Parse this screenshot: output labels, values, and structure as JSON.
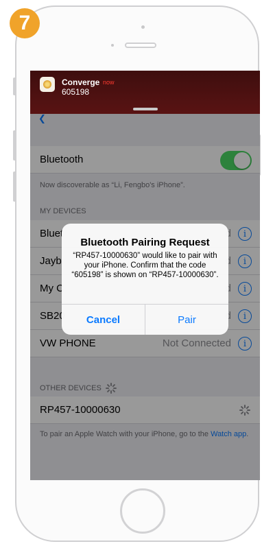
{
  "step_badge": "7",
  "notification": {
    "app_name": "Converge",
    "time": "now",
    "body": "605198"
  },
  "settings": {
    "bluetooth_label": "Bluetooth",
    "bluetooth_on": true,
    "discoverable_text": "Now discoverable as “Li, Fengbo's iPhone”.",
    "my_devices_header": "MY DEVICES",
    "my_devices": [
      {
        "name": "Bluet",
        "status": "d"
      },
      {
        "name": "Jayb",
        "status": "d"
      },
      {
        "name": "My C",
        "status": "d"
      },
      {
        "name": "SB20",
        "status": "d"
      },
      {
        "name": "VW PHONE",
        "status": "Not Connected"
      }
    ],
    "other_devices_header": "OTHER DEVICES",
    "other_devices": [
      {
        "name": "RP457-10000630"
      }
    ],
    "watch_note": "To pair an Apple Watch with your iPhone, go to the",
    "watch_link": "Watch app",
    "watch_note_end": "."
  },
  "alert": {
    "title": "Bluetooth Pairing Request",
    "message": "“RP457-10000630” would like to pair with your iPhone. Confirm that the code “605198” is shown on “RP457-10000630”.",
    "cancel_label": "Cancel",
    "pair_label": "Pair"
  },
  "colors": {
    "accent": "#0a7aff",
    "toggle_on": "#4cd964",
    "badge": "#f0a32a",
    "banner": "#591313"
  }
}
